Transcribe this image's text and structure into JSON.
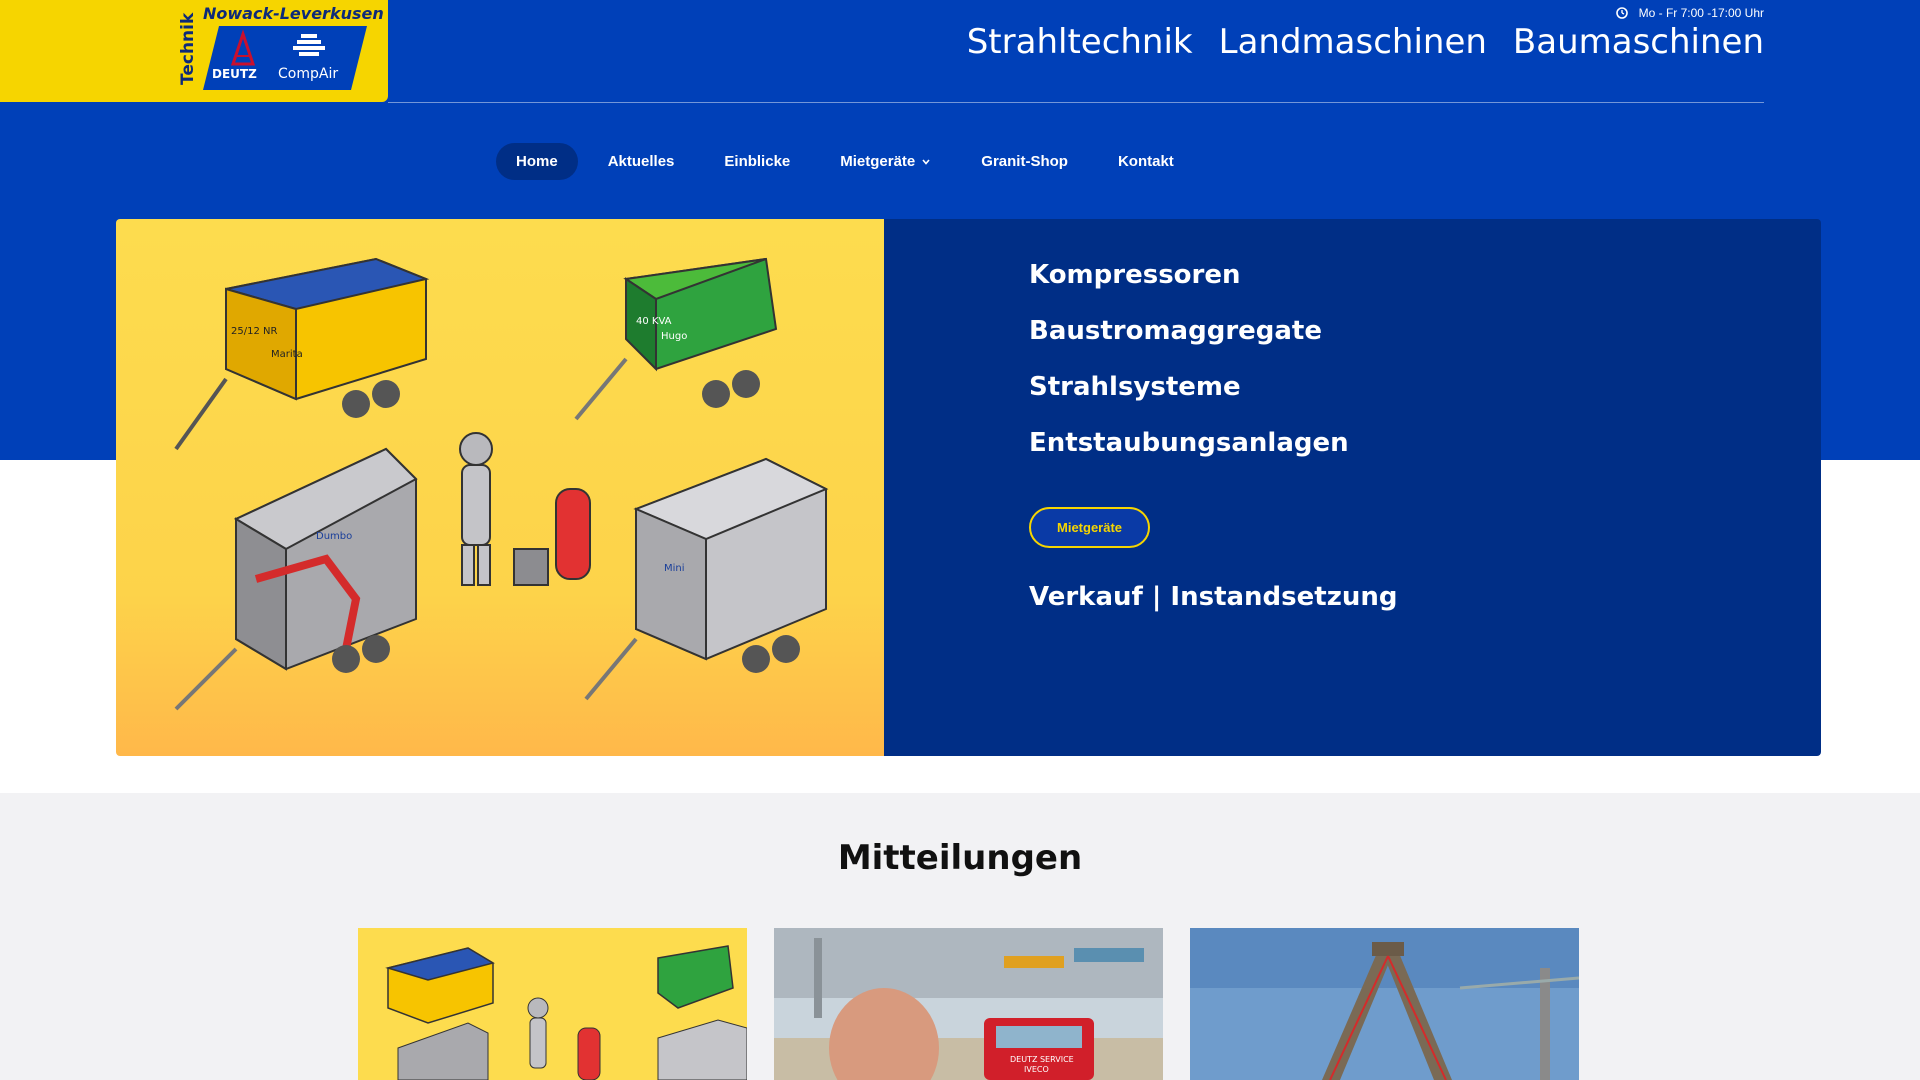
{
  "brand": {
    "vertical_text": "Technik",
    "top_text": "Nowack-Leverkusen",
    "deutz_label": "DEUTZ",
    "compair_label": "CompAir"
  },
  "header": {
    "hours": "Mo - Fr 7:00 -17:00 Uhr",
    "hours_icon": "clock-icon",
    "top_links": [
      "Strahltechnik",
      "Landmaschinen",
      "Baumaschinen"
    ]
  },
  "nav": {
    "items": [
      "Home",
      "Aktuelles",
      "Einblicke",
      "Mietgeräte",
      "Granit-Shop",
      "Kontakt"
    ],
    "active": "Home",
    "dropdown_icon": "chevron-down-icon"
  },
  "hero": {
    "services": [
      "Kompressoren",
      "Baustromaggregate",
      "Strahlsysteme",
      "Entstaubungsanlagen"
    ],
    "button_label": "Mietgeräte",
    "sales_text": "Verkauf | Instandsetzung",
    "machine_labels": [
      "25/12 NR",
      "Marita",
      "40 KVA",
      "Hugo",
      "Dumbo",
      "Mini"
    ]
  },
  "news": {
    "heading": "Mitteilungen",
    "van_label": "DEUTZ SERVICE",
    "van_brand": "IVECO"
  },
  "colors": {
    "primary_blue": "#0040b8",
    "dark_blue": "#002e86",
    "yellow": "#f6d500",
    "grey_bg": "#f2f2f4"
  }
}
